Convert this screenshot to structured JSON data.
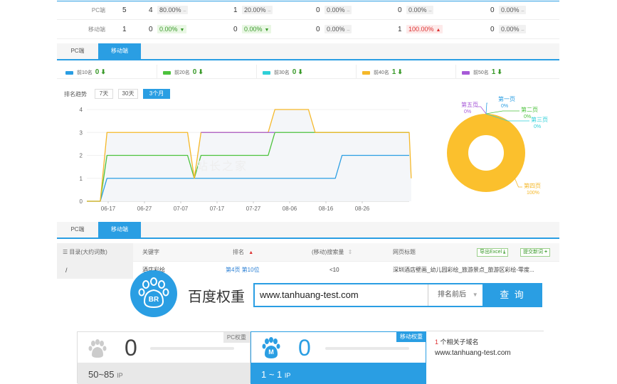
{
  "top_table": {
    "rows": [
      {
        "label": "PC端",
        "cells": [
          "5",
          "4",
          "80.00%",
          "",
          "1",
          "20.00%",
          "",
          "0",
          "0.00%",
          "",
          "0",
          "0.00%",
          "",
          "0",
          "0.00%",
          ""
        ],
        "c": [
          {
            "n": "5"
          },
          {
            "n": "4",
            "p": "80.00%",
            "d": "–",
            "t": "plain"
          },
          {
            "n": "1",
            "p": "20.00%",
            "d": "–",
            "t": "plain"
          },
          {
            "n": "0",
            "p": "0.00%",
            "d": "–",
            "t": "plain"
          },
          {
            "n": "0",
            "p": "0.00%",
            "d": "–",
            "t": "plain"
          },
          {
            "n": "0",
            "p": "0.00%",
            "d": "–",
            "t": "plain"
          }
        ]
      },
      {
        "label": "移动端",
        "c": [
          {
            "n": "1"
          },
          {
            "n": "0",
            "p": "0.00%",
            "d": "▼",
            "t": "green"
          },
          {
            "n": "0",
            "p": "0.00%",
            "d": "▼",
            "t": "green"
          },
          {
            "n": "0",
            "p": "0.00%",
            "d": "–",
            "t": "plain"
          },
          {
            "n": "1",
            "p": "100.00%",
            "d": "▲",
            "t": "red"
          },
          {
            "n": "0",
            "p": "0.00%",
            "d": "–",
            "t": "plain"
          }
        ]
      }
    ]
  },
  "tabs1": {
    "pc": "PC端",
    "mobile": "移动端"
  },
  "legend": [
    {
      "label": "前10名",
      "count": "0",
      "arrow": "⬇",
      "color": "#2a9ee3",
      "cc": "#3a9a2a"
    },
    {
      "label": "前20名",
      "count": "0",
      "arrow": "⬇",
      "color": "#4cc23c",
      "cc": "#3a9a2a"
    },
    {
      "label": "前30名",
      "count": "0",
      "arrow": "⬇",
      "color": "#2fd0d8",
      "cc": "#3a9a2a"
    },
    {
      "label": "前40名",
      "count": "1",
      "arrow": "⬇",
      "color": "#f5b829",
      "cc": "#3a9a2a"
    },
    {
      "label": "前50名",
      "count": "1",
      "arrow": "⬇",
      "color": "#a75ad8",
      "cc": "#3a9a2a"
    }
  ],
  "trend": {
    "label": "排名趋势",
    "ranges": [
      "7天",
      "30天",
      "3个月"
    ],
    "active": "3个月",
    "watermark": "站长之家"
  },
  "chart_data": {
    "type": "line",
    "x": [
      "06-17",
      "06-27",
      "07-07",
      "07-17",
      "07-27",
      "08-06",
      "08-16",
      "08-26"
    ],
    "ylim": [
      0,
      4
    ],
    "yticks": [
      "0",
      "1",
      "2",
      "3",
      "4"
    ],
    "series": [
      {
        "color": "#2a9ee3",
        "points": [
          [
            0,
            0
          ],
          [
            2,
            0
          ],
          [
            3,
            1
          ],
          [
            20,
            1
          ],
          [
            21,
            1
          ],
          [
            37,
            1
          ],
          [
            38,
            2
          ],
          [
            48,
            2
          ]
        ]
      },
      {
        "color": "#4cc23c",
        "points": [
          [
            0,
            0
          ],
          [
            2,
            0
          ],
          [
            3,
            2
          ],
          [
            15,
            2
          ],
          [
            16,
            1
          ],
          [
            17,
            2
          ],
          [
            27,
            2
          ],
          [
            28,
            3
          ],
          [
            48,
            3
          ]
        ]
      },
      {
        "color": "#f5b829",
        "points": [
          [
            0,
            0
          ],
          [
            2,
            0
          ],
          [
            3,
            3
          ],
          [
            15,
            3
          ],
          [
            16,
            1
          ],
          [
            17,
            3
          ],
          [
            27,
            3
          ],
          [
            28,
            4
          ],
          [
            33,
            4
          ],
          [
            34,
            3
          ],
          [
            48,
            3
          ],
          [
            48.3,
            1
          ]
        ]
      },
      {
        "color": "#a75ad8",
        "points": [
          [
            17,
            3
          ],
          [
            27,
            3
          ],
          [
            28,
            3
          ]
        ]
      }
    ]
  },
  "pie": {
    "labels": [
      {
        "text": "第一页",
        "pct": "0%",
        "color": "#2a9ee3"
      },
      {
        "text": "第二页",
        "pct": "0%",
        "color": "#4cc23c"
      },
      {
        "text": "第三页",
        "pct": "0%",
        "color": "#2fd0d8"
      },
      {
        "text": "第四页",
        "pct": "100%",
        "color": "#f5b829"
      },
      {
        "text": "第五页",
        "pct": "0%",
        "color": "#a75ad8"
      }
    ],
    "fill": "#fbc02d"
  },
  "tabs2": {
    "pc": "PC端",
    "mobile": "移动端"
  },
  "kw_table": {
    "dir_label": "目录(大约词数)",
    "dir_value": "/",
    "headers": {
      "keyword": "关键字",
      "rank": "排名",
      "rank_arrow": "▲",
      "volume": "(移动)搜索量",
      "volume_arrow": "⇕",
      "title": "网页标题"
    },
    "export": "导出Excel",
    "add": "提交新词",
    "row": {
      "keyword": "酒店彩绘",
      "rank": "第4页 第10位",
      "volume": "<10",
      "title": "深圳酒店壁画_幼儿园彩绘_旅游景点_旅游区彩绘-零度..."
    }
  },
  "br": {
    "logo": "BR",
    "title": "百度权重",
    "url": "www.tanhuang-test.com",
    "select": "排名前后",
    "search": "查 询"
  },
  "cards": [
    {
      "tag": "PC权重",
      "weight": "0",
      "ip": "50~85",
      "ip_unit": "IP",
      "letter": ""
    },
    {
      "tag": "移动权重",
      "weight": "0",
      "ip": "1 ~ 1",
      "ip_unit": "IP",
      "letter": "M"
    }
  ],
  "related": {
    "count": "1",
    "text": "个相关子域名",
    "domain": "www.tanhuang-test.com"
  }
}
